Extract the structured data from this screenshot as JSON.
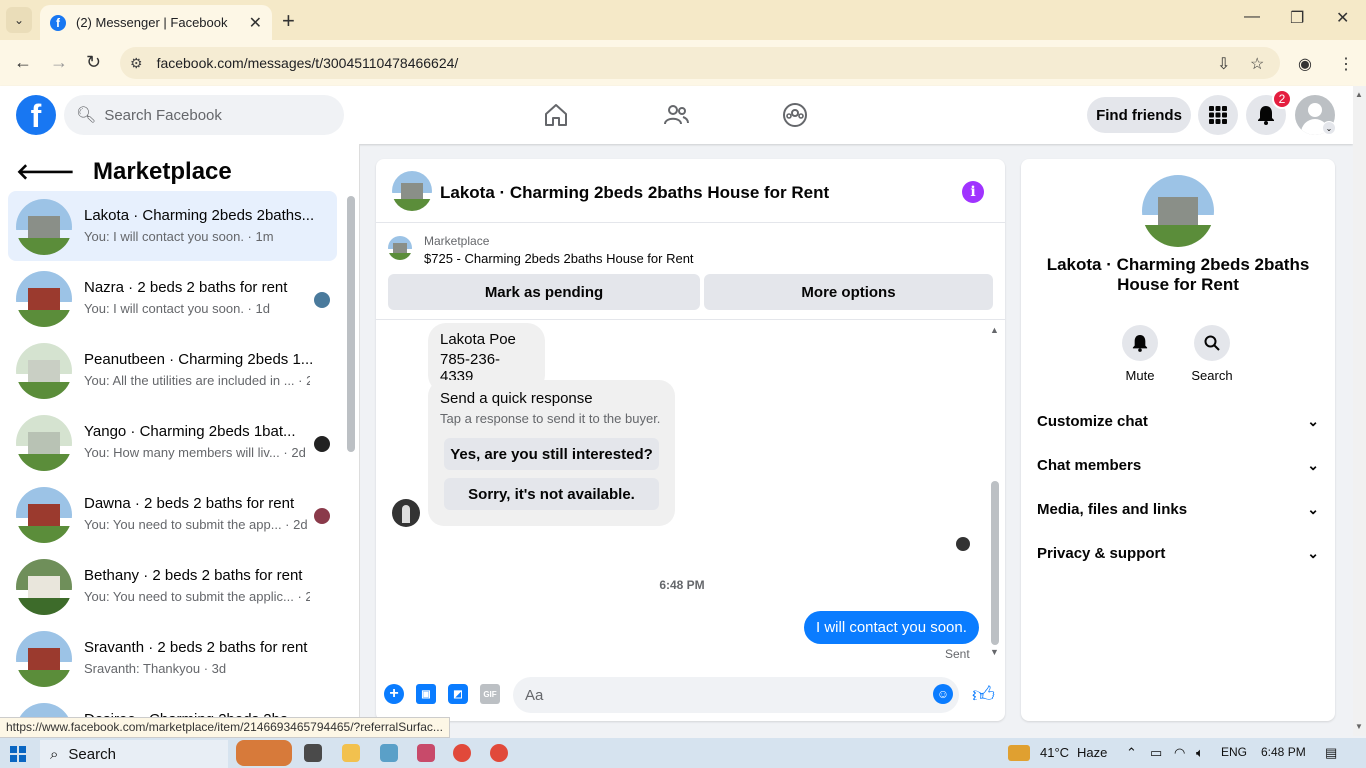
{
  "browser": {
    "tab_title": "(2) Messenger | Facebook",
    "url": "facebook.com/messages/t/30045110478466624/",
    "new_tab": "+",
    "close_tab": "✕",
    "minimize": "—",
    "maximize": "❐",
    "close_window": "✕"
  },
  "header": {
    "search_placeholder": "Search Facebook",
    "find_friends": "Find friends",
    "notification_count": "2"
  },
  "left_panel": {
    "title": "Marketplace",
    "conversations": [
      {
        "title": "Lakota · Charming 2beds 2baths...",
        "subtitle": "You: I will contact you soon. · 1m",
        "active": true
      },
      {
        "title": "Nazra · 2 beds 2 baths for rent",
        "subtitle": "You: I will contact you soon. · 1d"
      },
      {
        "title": "Peanutbeen · Charming 2beds 1...",
        "subtitle": "You: All the utilities are included in ... · 2d"
      },
      {
        "title": "Yango · Charming 2beds 1bat...",
        "subtitle": "You: How many members will liv... · 2d"
      },
      {
        "title": "Dawna · 2 beds 2 baths for rent",
        "subtitle": "You: You need to submit the app... · 2d"
      },
      {
        "title": "Bethany · 2 beds 2 baths for rent",
        "subtitle": "You: You need to submit the applic... · 2d"
      },
      {
        "title": "Sravanth · 2 beds 2 baths for rent",
        "subtitle": "Sravanth: Thankyou · 3d"
      },
      {
        "title": "Desiree · Charming 2beds 2ba...",
        "subtitle": ""
      }
    ]
  },
  "chat": {
    "title": "Lakota · Charming 2beds 2baths House for Rent",
    "marketplace_label": "Marketplace",
    "listing": "$725 - Charming 2beds 2baths House for Rent",
    "mark_pending": "Mark as pending",
    "more_options": "More options",
    "contact_name": "Lakota Poe",
    "contact_phone": "785-236-4339",
    "quick_title": "Send a quick response",
    "quick_sub": "Tap a response to send it to the buyer.",
    "quick_1": "Yes, are you still interested?",
    "quick_2": "Sorry, it's not available.",
    "time": "6:48 PM",
    "my_message": "I will contact you soon.",
    "sent": "Sent",
    "composer_placeholder": "Aa",
    "gif": "GIF"
  },
  "right_panel": {
    "title": "Lakota · Charming 2beds 2baths House for Rent",
    "mute": "Mute",
    "search": "Search",
    "sections": [
      "Customize chat",
      "Chat members",
      "Media, files and links",
      "Privacy & support"
    ]
  },
  "status_url": "https://www.facebook.com/marketplace/item/2146693465794465/?referralSurfac...",
  "taskbar": {
    "search": "Search",
    "temp": "41°C",
    "weather": "Haze",
    "lang": "ENG",
    "time": "6:48 PM"
  },
  "colors": {
    "fb_blue": "#1877f2",
    "messenger_blue": "#0a7cff",
    "info_purple": "#a033ff",
    "active_row": "#e7f0fd"
  }
}
